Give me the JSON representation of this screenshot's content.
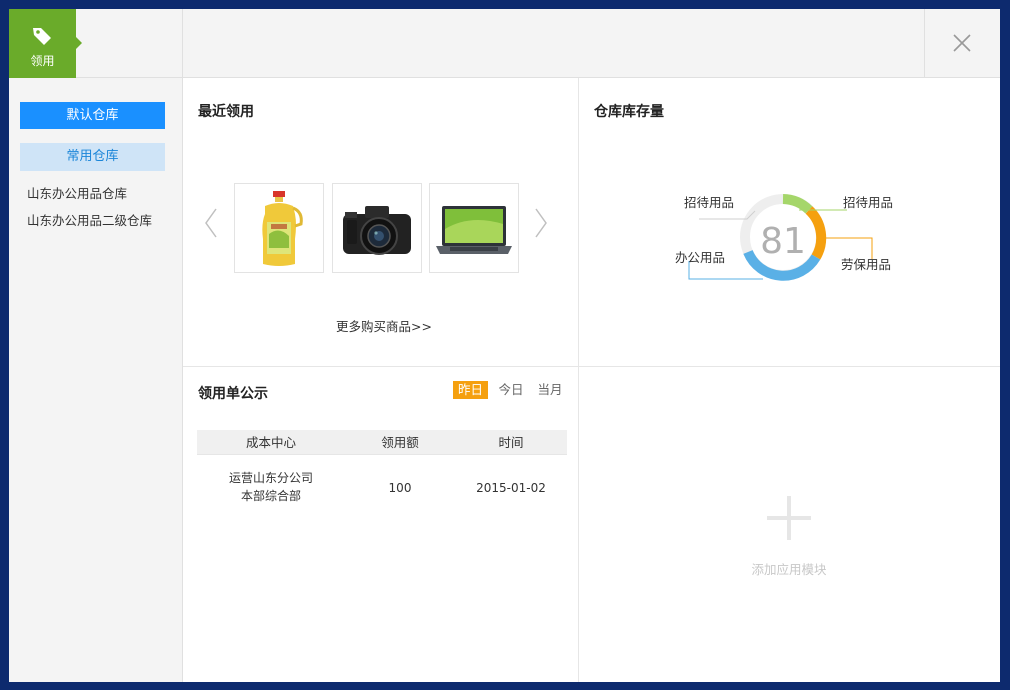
{
  "header": {
    "tab_label": "领用",
    "tab_icon": "tag-icon",
    "close_icon": "close-icon",
    "accent_color": "#6aab2a"
  },
  "sidebar": {
    "default_warehouse": "默认仓库",
    "common_warehouse": "常用仓库",
    "warehouses": [
      "山东办公用品仓库",
      "山东办公用品二级仓库"
    ]
  },
  "recent": {
    "title": "最近领用",
    "items": [
      {
        "name": "oil-bottle",
        "icon": "oil-bottle-icon"
      },
      {
        "name": "camera",
        "icon": "camera-icon"
      },
      {
        "name": "laptop",
        "icon": "laptop-icon"
      }
    ],
    "more_link": "更多购买商品>>"
  },
  "inventory": {
    "title": "仓库库存量",
    "total": "81",
    "legend": [
      "招待用品",
      "招待用品",
      "劳保用品",
      "办公用品"
    ],
    "colors": {
      "green": "#a5d66a",
      "orange": "#f5a00f",
      "blue": "#5ab0e6",
      "grey": "#eeeeee"
    }
  },
  "notice": {
    "title": "领用单公示",
    "filters": [
      "昨日",
      "今日",
      "当月"
    ],
    "active_filter": "昨日",
    "columns": [
      "成本中心",
      "领用额",
      "时间"
    ],
    "rows": [
      {
        "center_line1": "运营山东分公司",
        "center_line2": "本部综合部",
        "amount": "100",
        "date": "2015-01-02"
      }
    ]
  },
  "add_module": {
    "label": "添加应用模块"
  }
}
